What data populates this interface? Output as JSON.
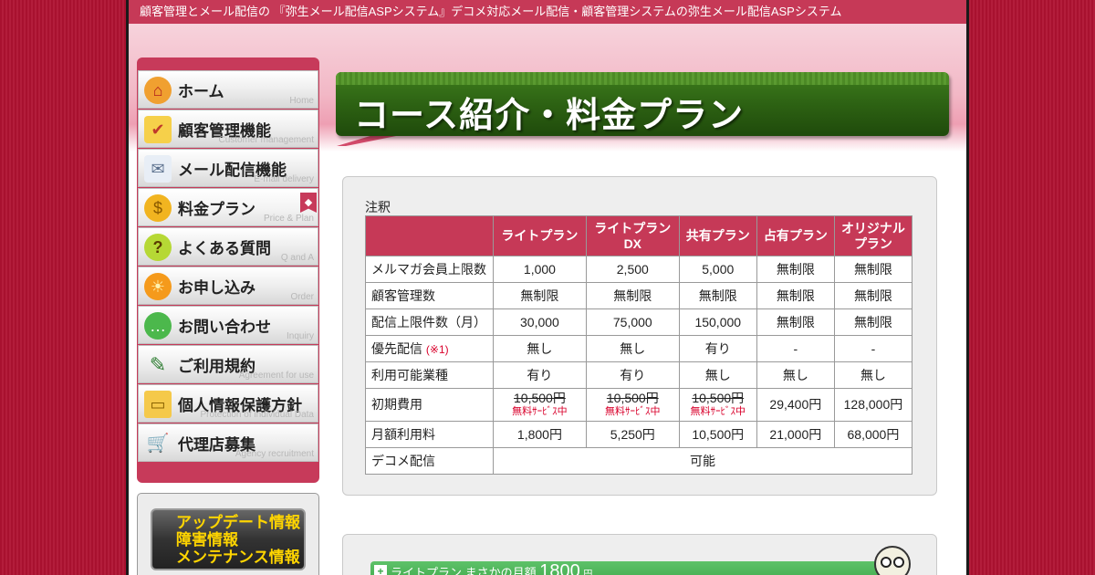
{
  "header": {
    "tagline": "顧客管理とメール配信の 『弥生メール配信ASPシステム』デコメ対応メール配信・顧客管理システムの弥生メール配信ASPシステム"
  },
  "nav": {
    "items": [
      {
        "label": "ホーム",
        "sub": "Home",
        "icon": "house-icon"
      },
      {
        "label": "顧客管理機能",
        "sub": "Customer management",
        "icon": "checklist-icon"
      },
      {
        "label": "メール配信機能",
        "sub": "E-mail delivery",
        "icon": "envelope-icon"
      },
      {
        "label": "料金プラン",
        "sub": "Price & Plan",
        "icon": "coins-icon"
      },
      {
        "label": "よくある質問",
        "sub": "Q and A",
        "icon": "question-icon"
      },
      {
        "label": "お申し込み",
        "sub": "Order",
        "icon": "sun-icon"
      },
      {
        "label": "お問い合わせ",
        "sub": "Inquiry",
        "icon": "chat-bubble-icon"
      },
      {
        "label": "ご利用規約",
        "sub": "Agreement for use",
        "icon": "pencil-icon"
      },
      {
        "label": "個人情報保護方針",
        "sub": "Protection of individual Data",
        "icon": "folder-icon"
      },
      {
        "label": "代理店募集",
        "sub": "Agency recruitment",
        "icon": "cart-icon"
      }
    ]
  },
  "info": {
    "line1": "アップデート情報",
    "line2": "障害情報",
    "line3": "メンテナンス情報"
  },
  "page": {
    "title": "コース紹介・料金プラン",
    "note": "注釈"
  },
  "table": {
    "headers": [
      "ライトプラン",
      "ライトプラン\nDX",
      "共有プラン",
      "占有プラン",
      "オリジナル\nプラン"
    ],
    "rows": [
      {
        "label": "メルマガ会員上限数",
        "cells": [
          "1,000",
          "2,500",
          "5,000",
          "無制限",
          "無制限"
        ]
      },
      {
        "label": "顧客管理数",
        "cells": [
          "無制限",
          "無制限",
          "無制限",
          "無制限",
          "無制限"
        ]
      },
      {
        "label": "配信上限件数（月）",
        "cells": [
          "30,000",
          "75,000",
          "150,000",
          "無制限",
          "無制限"
        ]
      },
      {
        "label": "優先配信",
        "label_note": "(※1)",
        "cells": [
          "無し",
          "無し",
          "有り",
          "-",
          "-"
        ]
      },
      {
        "label": "利用可能業種",
        "cells": [
          "有り",
          "有り",
          "無し",
          "無し",
          "無し"
        ]
      },
      {
        "label": "初期費用",
        "cells": [
          "10,500円",
          "10,500円",
          "10,500円",
          "29,400円",
          "128,000円"
        ],
        "free_note": "無料ｻｰﾋﾞｽ中"
      },
      {
        "label": "月額利用料",
        "cells": [
          "1,800円",
          "5,250円",
          "10,500円",
          "21,000円",
          "68,000円"
        ]
      },
      {
        "label": "デコメ配信",
        "cells": [
          "可能"
        ]
      }
    ]
  },
  "promo": {
    "text": "ライトプラン まさかの月額",
    "amount": "1800",
    "unit": "円"
  }
}
